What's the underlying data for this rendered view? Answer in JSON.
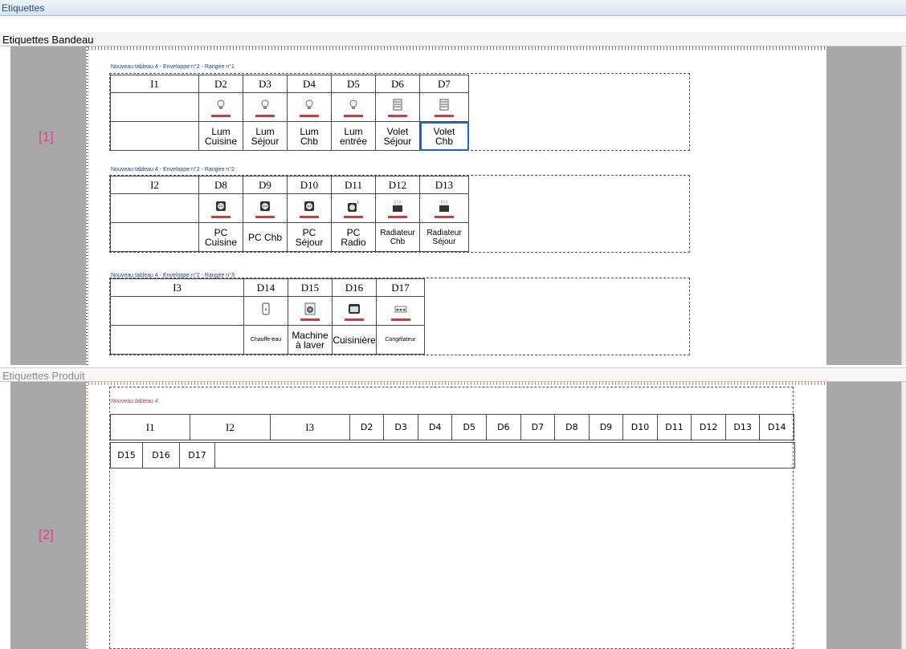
{
  "window": {
    "title": "Etiquettes"
  },
  "sections": {
    "bandeau": {
      "title": "Etiquettes Bandeau",
      "marker": "[1]"
    },
    "produit": {
      "title": "Etiquettes Produit",
      "marker": "[2]"
    }
  },
  "bandeau_rows": [
    {
      "label": "Nouveau tableau 4 - Enveloppe n°2 - Rangée n°1",
      "cells": [
        {
          "id": "I1",
          "icon": "",
          "l1": "",
          "l2": ""
        },
        {
          "id": "D2",
          "icon": "bulb-icon",
          "l1": "Lum",
          "l2": "Cuisine"
        },
        {
          "id": "D3",
          "icon": "bulb-icon",
          "l1": "Lum",
          "l2": "Séjour"
        },
        {
          "id": "D4",
          "icon": "bulb-icon",
          "l1": "Lum",
          "l2": "Chb"
        },
        {
          "id": "D5",
          "icon": "bulb-icon",
          "l1": "Lum",
          "l2": "entrée"
        },
        {
          "id": "D6",
          "icon": "shutter-icon",
          "l1": "Volet",
          "l2": "Séjour"
        },
        {
          "id": "D7",
          "icon": "shutter-icon",
          "l1": "Volet",
          "l2": "Chb"
        }
      ]
    },
    {
      "label": "Nouveau tableau 4 - Enveloppe n°2 - Rangée n°2",
      "cells": [
        {
          "id": "I2",
          "icon": "",
          "l1": "",
          "l2": ""
        },
        {
          "id": "D8",
          "icon": "socket-icon",
          "l1": "PC",
          "l2": "Cuisine"
        },
        {
          "id": "D9",
          "icon": "socket-icon",
          "l1": "PC Chb",
          "l2": ""
        },
        {
          "id": "D10",
          "icon": "socket-icon",
          "l1": "PC",
          "l2": "Séjour"
        },
        {
          "id": "D11",
          "icon": "socket-radio-icon",
          "l1": "PC",
          "l2": "Radio"
        },
        {
          "id": "D12",
          "icon": "radiator-icon",
          "l1": "Radiateur",
          "l2": "Chb"
        },
        {
          "id": "D13",
          "icon": "radiator-icon",
          "l1": "Radiateur",
          "l2": "Séjour"
        }
      ]
    },
    {
      "label": "Nouveau tableau 4 - Enveloppe n°2 - Rangée n°3",
      "cells": [
        {
          "id": "I3",
          "icon": "",
          "l1": "",
          "l2": ""
        },
        {
          "id": "D14",
          "icon": "water-heater-icon",
          "l1": "Chauffe-eau",
          "l2": ""
        },
        {
          "id": "D15",
          "icon": "washing-machine-icon",
          "l1": "Machine",
          "l2": "à laver"
        },
        {
          "id": "D16",
          "icon": "oven-icon",
          "l1": "Cuisinière",
          "l2": ""
        },
        {
          "id": "D17",
          "icon": "freezer-icon",
          "l1": "Congélateur",
          "l2": ""
        }
      ]
    }
  ],
  "produit": {
    "label": "Nouveau tableau 4",
    "row1": [
      "I1",
      "I2",
      "I3",
      "D2",
      "D3",
      "D4",
      "D5",
      "D6",
      "D7",
      "D8",
      "D9",
      "D10",
      "D11",
      "D12",
      "D13",
      "D14"
    ],
    "row2": [
      "D15",
      "D16",
      "D17"
    ]
  },
  "colors": {
    "selection": "#1b6ac9",
    "icon_bar": "#e03535",
    "marker": "#e0418f"
  }
}
